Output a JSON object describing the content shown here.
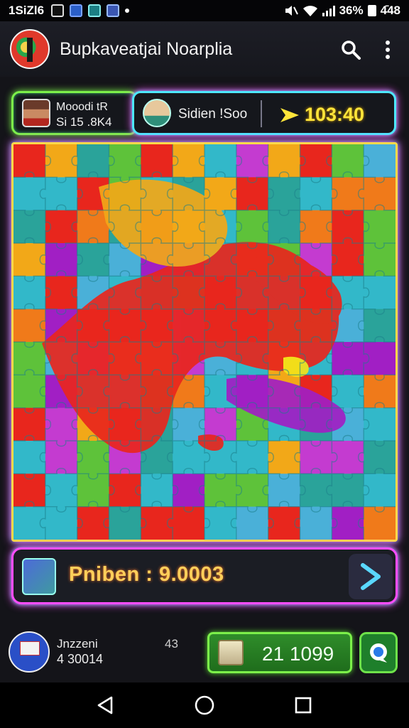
{
  "status_bar": {
    "time": "1SiZl6",
    "signal_text": "36%",
    "battery_text": "4̄48"
  },
  "app": {
    "title": "Bupkaveatjai Noarplia"
  },
  "players": {
    "player1": {
      "name": "Mooodi tR",
      "score": "Si 15 .8K4"
    },
    "player2": {
      "name": "Sidien !Soo"
    },
    "timer": "103:40"
  },
  "progress": {
    "label": "Pniben : 9.0003"
  },
  "bottom": {
    "user_name": "Jnzzeni",
    "user_score": "4 30014",
    "level": "43",
    "coins": "21 1099"
  },
  "colors": {
    "accent_green": "#7cf04a",
    "accent_cyan": "#4de8ff",
    "accent_magenta": "#ff4df2",
    "timer_yellow": "#ffe53a",
    "progress_orange": "#ffcf5a"
  },
  "icons": {
    "header": [
      "search-icon",
      "more-vert-icon"
    ],
    "nav": [
      "back-icon",
      "home-icon",
      "recents-icon"
    ]
  }
}
